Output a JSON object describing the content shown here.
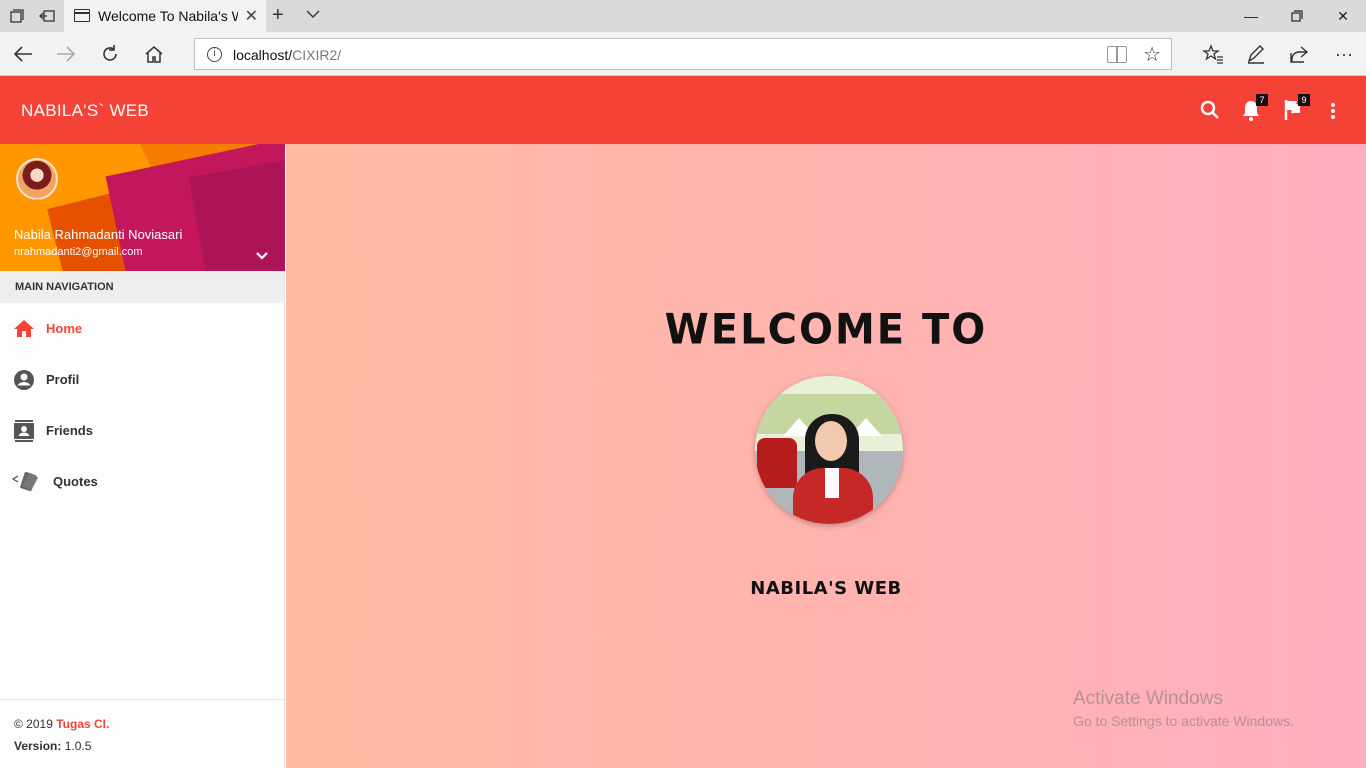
{
  "browser": {
    "tab_title": "Welcome To Nabila's W",
    "url_host": "localhost/",
    "url_path": "CIXIR2/"
  },
  "header": {
    "brand": "NABILA'S` WEB",
    "notifications_count": "7",
    "tasks_count": "9"
  },
  "user": {
    "name": "Nabila Rahmadanti Noviasari",
    "email": "nrahmadanti2@gmail.com"
  },
  "sidebar": {
    "section_title": "MAIN NAVIGATION",
    "items": [
      {
        "label": "Home",
        "icon": "home-icon",
        "active": true
      },
      {
        "label": "Profil",
        "icon": "account-circle-icon",
        "active": false
      },
      {
        "label": "Friends",
        "icon": "contacts-icon",
        "active": false
      },
      {
        "label": "Quotes",
        "icon": "cards-icon",
        "active": false
      }
    ],
    "footer": {
      "copyright_prefix": "© 2019 ",
      "copyright_link": "Tugas CI.",
      "version_label": "Version:",
      "version_value": " 1.0.5"
    }
  },
  "main": {
    "welcome": "WELCOME TO",
    "site_name": "NABILA'S WEB"
  },
  "os_watermark": {
    "line1": "Activate Windows",
    "line2": "Go to Settings to activate Windows."
  },
  "colors": {
    "accent": "#f44336",
    "bg_left": "#ffbca3",
    "bg_right": "#ffaec0"
  }
}
